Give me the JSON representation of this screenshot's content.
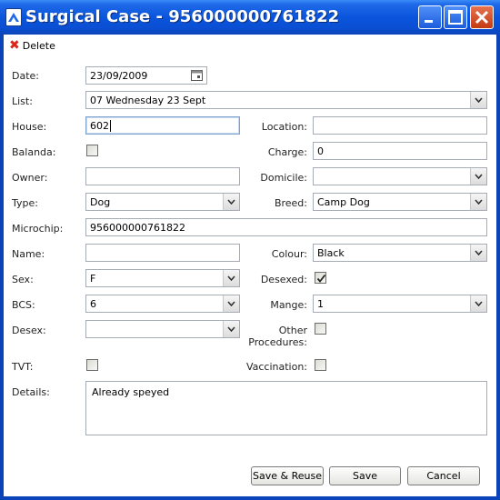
{
  "window": {
    "title": "Surgical Case - 956000000761822"
  },
  "toolbar": {
    "delete_label": "Delete"
  },
  "labels": {
    "date": "Date:",
    "list": "List:",
    "house": "House:",
    "location": "Location:",
    "balanda": "Balanda:",
    "charge": "Charge:",
    "owner": "Owner:",
    "domicile": "Domicile:",
    "type": "Type:",
    "breed": "Breed:",
    "microchip": "Microchip:",
    "name": "Name:",
    "colour": "Colour:",
    "sex": "Sex:",
    "desexed": "Desexed:",
    "bcs": "BCS:",
    "mange": "Mange:",
    "desex": "Desex:",
    "other_procedures_1": "Other",
    "other_procedures_2": "Procedures:",
    "tvt": "TVT:",
    "vaccination": "Vaccination:",
    "details": "Details:"
  },
  "values": {
    "date": "23/09/2009",
    "list": "07 Wednesday 23 Sept",
    "house": "602",
    "location": "",
    "balanda": false,
    "charge": "0",
    "owner": "",
    "domicile": "",
    "type": "Dog",
    "breed": "Camp Dog",
    "microchip": "956000000761822",
    "name": "",
    "colour": "Black",
    "sex": "F",
    "desexed": true,
    "bcs": "6",
    "mange": "1",
    "desex": "",
    "other_procedures": false,
    "tvt": false,
    "vaccination": false,
    "details": "Already speyed"
  },
  "buttons": {
    "save_reuse": "Save & Reuse",
    "save": "Save",
    "cancel": "Cancel"
  }
}
